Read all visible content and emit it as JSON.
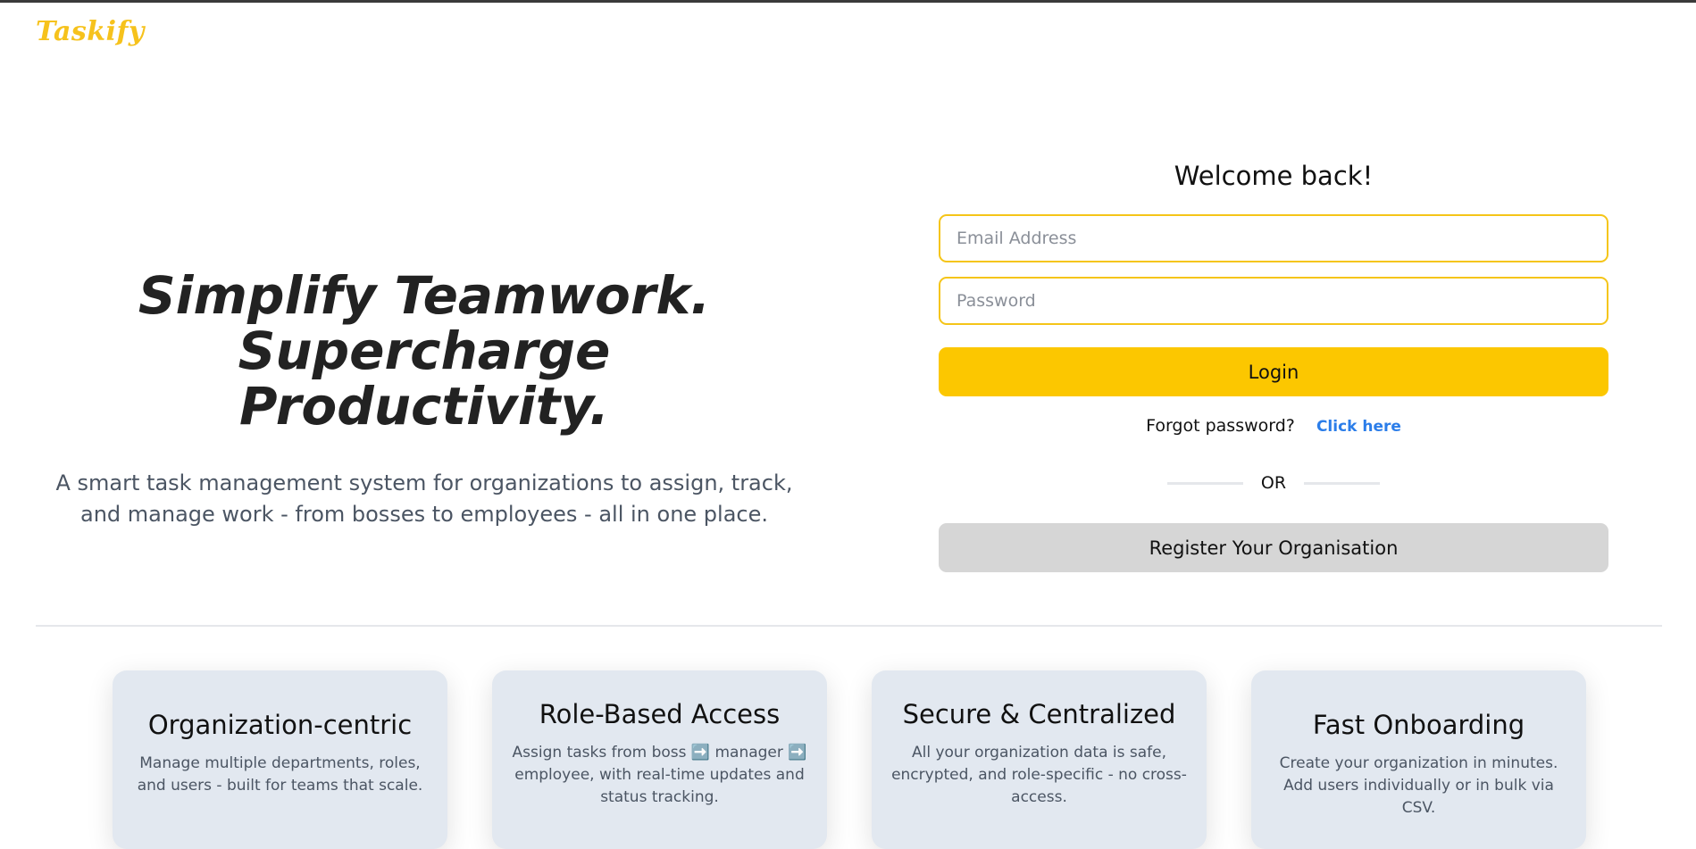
{
  "brand": "Taskify",
  "hero": {
    "title_line1": "Simplify Teamwork.",
    "title_line2": "Supercharge Productivity.",
    "subtitle": "A smart task management system for organizations to assign, track, and manage work - from bosses to employees - all in one place."
  },
  "login": {
    "heading": "Welcome back!",
    "email_placeholder": "Email Address",
    "password_placeholder": "Password",
    "login_label": "Login",
    "forgot_text": "Forgot password?",
    "forgot_link": "Click here",
    "or_text": "OR",
    "register_label": "Register Your Organisation"
  },
  "features": [
    {
      "title": "Organization-centric",
      "desc": "Manage multiple departments, roles, and users - built for teams that scale."
    },
    {
      "title": "Role-Based Access",
      "desc": "Assign tasks from boss ➡️ manager ➡️ employee, with real-time updates and status tracking."
    },
    {
      "title": "Secure & Centralized",
      "desc": "All your organization data is safe, encrypted, and role-specific - no cross-access."
    },
    {
      "title": "Fast Onboarding",
      "desc": "Create your organization in minutes. Add users individually or in bulk via CSV."
    }
  ],
  "colors": {
    "accent": "#fcc700",
    "brand": "#f6c21c",
    "link": "#2b7de9",
    "card_bg": "#e2e8f0"
  }
}
